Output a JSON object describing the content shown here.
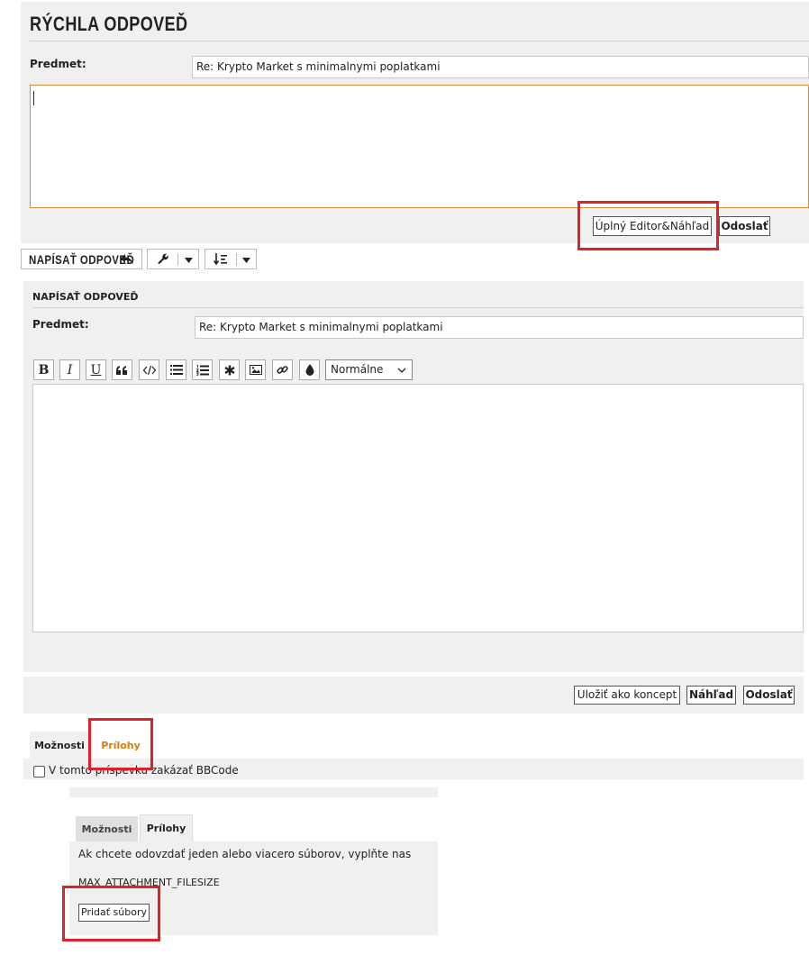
{
  "quick_reply": {
    "title": "RÝCHLA ODPOVEĎ",
    "subject_label": "Predmet:",
    "subject_value": "Re: Krypto Market s minimalnymi poplatkami",
    "full_editor_button": "Úplný Editor&Náhľad",
    "send_button": "Odoslať"
  },
  "toolbar": {
    "post_reply_button": "NAPÍSAŤ ODPOVEĎ"
  },
  "post_form": {
    "title": "NAPÍSAŤ ODPOVEĎ",
    "subject_label": "Predmet:",
    "subject_value": "Re: Krypto Market s minimalnymi poplatkami",
    "editor_buttons": [
      "B",
      "I",
      "U"
    ],
    "font_size_selected": "Normálne",
    "save_draft_button": "Uložiť ako koncept",
    "preview_button": "Náhľad",
    "send_button": "Odoslať"
  },
  "options_tabs": {
    "options_tab": "Možnosti",
    "attachments_tab": "Prílohy",
    "disable_bbcode_label": "V tomto príspevku zakázať BBCode"
  },
  "attachments_panel": {
    "options_tab": "Možnosti",
    "attachments_tab": "Prílohy",
    "instruction_text": "Ak chcete odovzdať jeden alebo viacero súborov, vyplňte nas",
    "max_filesize_text": "MAX_ATTACHMENT_FILESIZE",
    "add_files_button": "Pridať súbory"
  },
  "colors": {
    "highlight_red": "#e0202a",
    "active_tab_orange": "#e07b00",
    "panel_gray": "#f0f0f0",
    "textarea_focus_border": "#d88a3a"
  }
}
